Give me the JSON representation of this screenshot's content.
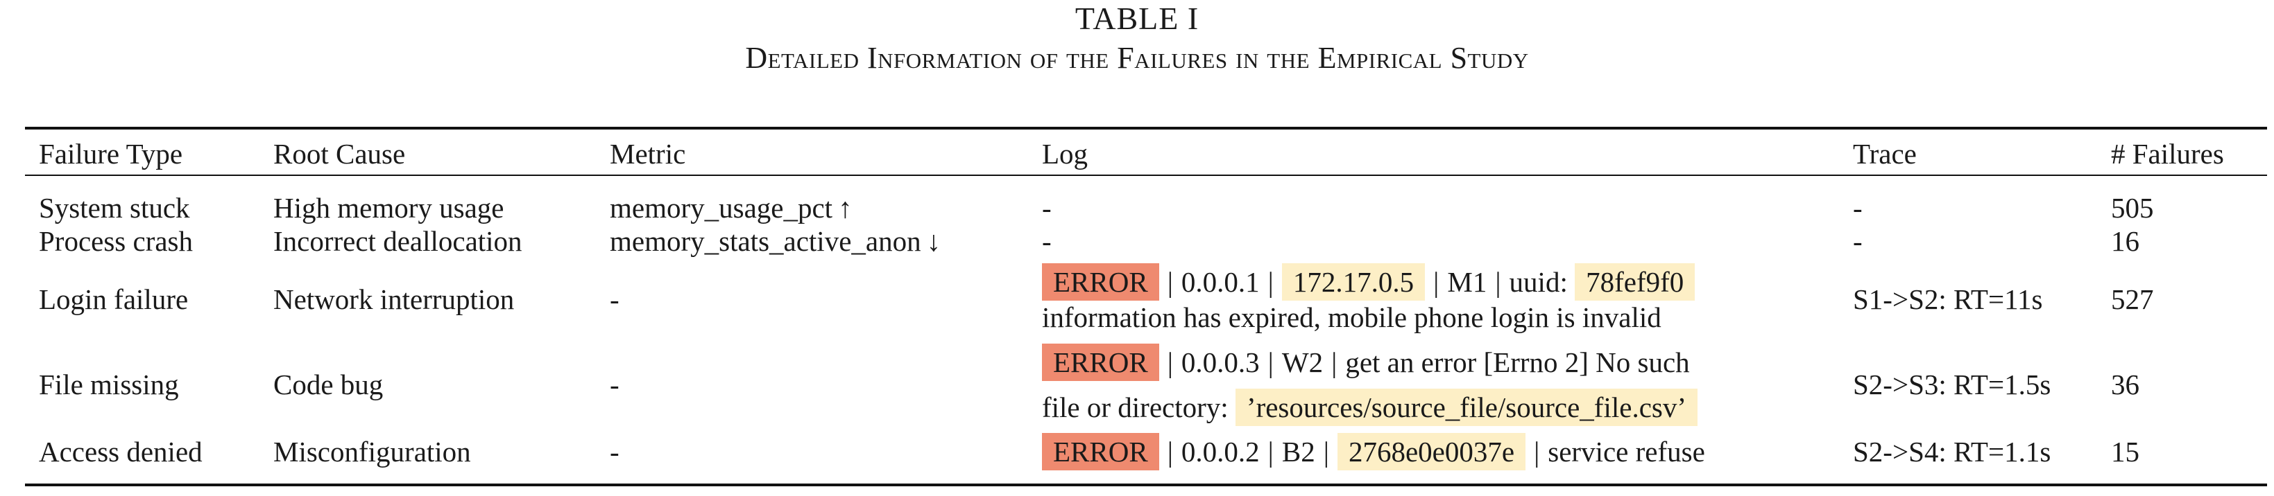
{
  "caption": {
    "label": "TABLE I",
    "title": "Detailed Information of the Failures in the Empirical Study"
  },
  "columns": {
    "failure_type": "Failure Type",
    "root_cause": "Root Cause",
    "metric": "Metric",
    "log": "Log",
    "trace": "Trace",
    "failures": "# Failures"
  },
  "rows": [
    {
      "failure_type": "System stuck",
      "root_cause": "High memory usage",
      "metric": "memory_usage_pct",
      "metric_arrow": "↑",
      "log": "-",
      "trace": "-",
      "failures": "505"
    },
    {
      "failure_type": "Process crash",
      "root_cause": "Incorrect deallocation",
      "metric": "memory_stats_active_anon",
      "metric_arrow": "↓",
      "log": "-",
      "trace": "-",
      "failures": "16"
    },
    {
      "failure_type": "Login failure",
      "root_cause": "Network interruption",
      "metric": "-",
      "log": {
        "level": "ERROR",
        "sep": "|",
        "ip1": "0.0.0.1",
        "ip2": "172.17.0.5",
        "node": "M1",
        "uuid_label": "uuid:",
        "uuid": "78fef9f0",
        "message": "information has expired, mobile phone login is invalid"
      },
      "trace": "S1->S2: RT=11s",
      "failures": "527"
    },
    {
      "failure_type": "File missing",
      "root_cause": "Code bug",
      "metric": "-",
      "log": {
        "level": "ERROR",
        "sep": "|",
        "ip": "0.0.0.3",
        "node": "W2",
        "message1": "get an error [Errno 2] No such",
        "message2": "file or directory:",
        "path": "’resources/source_file/source_file.csv’"
      },
      "trace": "S2->S3: RT=1.5s",
      "failures": "36"
    },
    {
      "failure_type": "Access denied",
      "root_cause": "Misconfiguration",
      "metric": "-",
      "log": {
        "level": "ERROR",
        "sep": "|",
        "ip": "0.0.0.2",
        "node": "B2",
        "id": "2768e0e0037e",
        "message": "service refuse"
      },
      "trace": "S2->S4: RT=1.1s",
      "failures": "15"
    }
  ],
  "colors": {
    "error_highlight": "#ef8a6f",
    "value_highlight": "#fdefc6",
    "text": "#1a1a1a"
  }
}
